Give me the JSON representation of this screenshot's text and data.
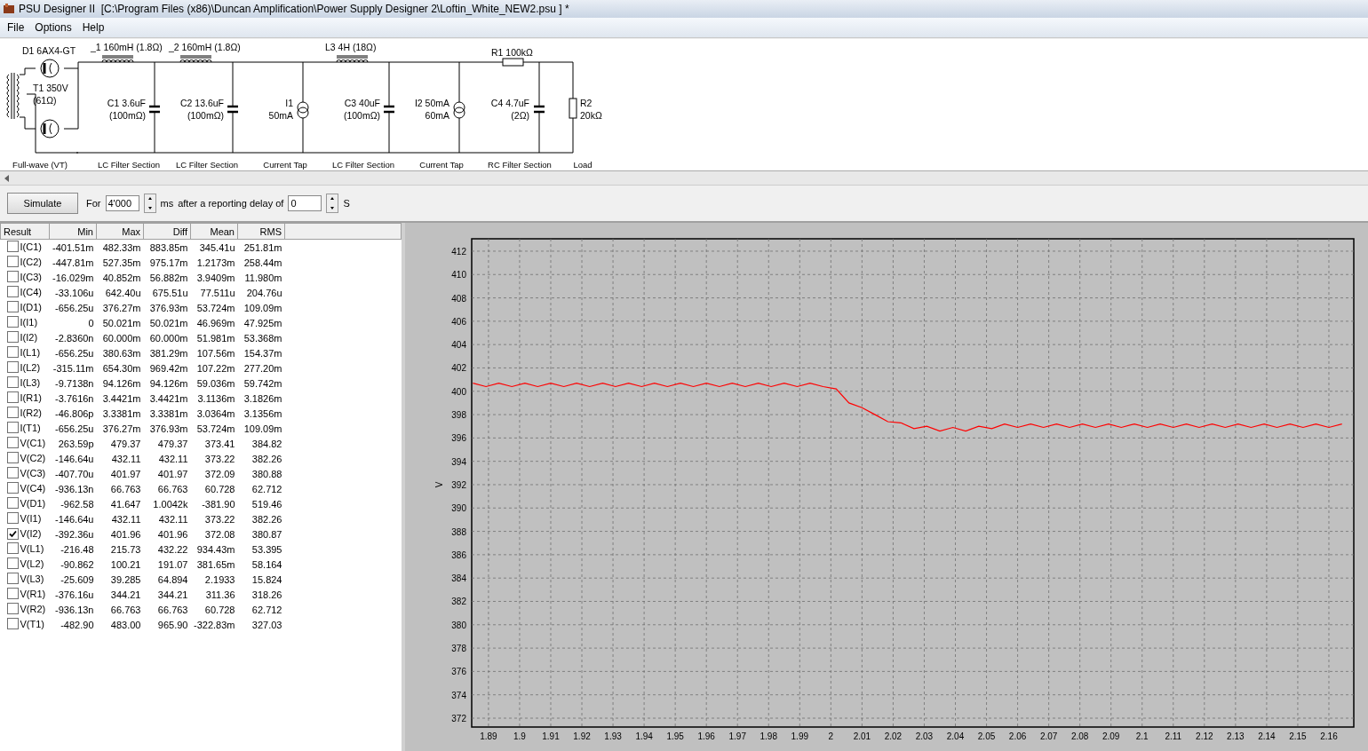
{
  "window": {
    "title": "PSU Designer II  [C:\\Program Files (x86)\\Duncan Amplification\\Power Supply Designer 2\\Loftin_White_NEW2.psu ] *"
  },
  "menu": [
    "File",
    "Options",
    "Help"
  ],
  "schematic": {
    "stages": [
      {
        "kind": "rectifier",
        "diode": "D1 6AX4-GT",
        "transformer": [
          "T1 350V",
          "(61Ω)"
        ],
        "section": "Full-wave (VT)"
      },
      {
        "kind": "lc",
        "inductor": "_1 160mH (1.8Ω)",
        "capacitor": [
          "C1 3.6uF",
          "(100mΩ)"
        ],
        "section": "LC Filter Section"
      },
      {
        "kind": "lc",
        "inductor": "_2 160mH (1.8Ω)",
        "capacitor": [
          "C2 13.6uF",
          "(100mΩ)"
        ],
        "section": "LC Filter Section"
      },
      {
        "kind": "tap",
        "source": [
          "I1",
          "50mA"
        ],
        "section": "Current Tap"
      },
      {
        "kind": "lc",
        "inductor": "L3 4H (18Ω)",
        "capacitor": [
          "C3 40uF",
          "(100mΩ)"
        ],
        "section": "LC Filter Section"
      },
      {
        "kind": "tap",
        "source": [
          "I2 50mA",
          "60mA"
        ],
        "section": "Current Tap"
      },
      {
        "kind": "rc",
        "resistor": "R1 100kΩ",
        "capacitor": [
          "C4 4.7uF",
          "(2Ω)"
        ],
        "section": "RC Filter Section"
      },
      {
        "kind": "load",
        "resistor": [
          "R2",
          "20kΩ"
        ],
        "section": "Load"
      }
    ]
  },
  "toolbar": {
    "simulate_button": "Simulate",
    "for_label": "For",
    "duration": "4'000",
    "duration_unit": "ms",
    "delay_label": "after a reporting delay of",
    "delay": "0",
    "delay_unit": "S"
  },
  "results": {
    "columns": [
      "Result",
      "Min",
      "Max",
      "Diff",
      "Mean",
      "RMS"
    ],
    "rows": [
      {
        "name": "I(C1)",
        "checked": false,
        "values": [
          "-401.51m",
          "482.33m",
          "883.85m",
          "345.41u",
          "251.81m"
        ]
      },
      {
        "name": "I(C2)",
        "checked": false,
        "values": [
          "-447.81m",
          "527.35m",
          "975.17m",
          "1.2173m",
          "258.44m"
        ]
      },
      {
        "name": "I(C3)",
        "checked": false,
        "values": [
          "-16.029m",
          "40.852m",
          "56.882m",
          "3.9409m",
          "11.980m"
        ]
      },
      {
        "name": "I(C4)",
        "checked": false,
        "values": [
          "-33.106u",
          "642.40u",
          "675.51u",
          "77.511u",
          "204.76u"
        ]
      },
      {
        "name": "I(D1)",
        "checked": false,
        "values": [
          "-656.25u",
          "376.27m",
          "376.93m",
          "53.724m",
          "109.09m"
        ]
      },
      {
        "name": "I(I1)",
        "checked": false,
        "values": [
          "0",
          "50.021m",
          "50.021m",
          "46.969m",
          "47.925m"
        ]
      },
      {
        "name": "I(I2)",
        "checked": false,
        "values": [
          "-2.8360n",
          "60.000m",
          "60.000m",
          "51.981m",
          "53.368m"
        ]
      },
      {
        "name": "I(L1)",
        "checked": false,
        "values": [
          "-656.25u",
          "380.63m",
          "381.29m",
          "107.56m",
          "154.37m"
        ]
      },
      {
        "name": "I(L2)",
        "checked": false,
        "values": [
          "-315.11m",
          "654.30m",
          "969.42m",
          "107.22m",
          "277.20m"
        ]
      },
      {
        "name": "I(L3)",
        "checked": false,
        "values": [
          "-9.7138n",
          "94.126m",
          "94.126m",
          "59.036m",
          "59.742m"
        ]
      },
      {
        "name": "I(R1)",
        "checked": false,
        "values": [
          "-3.7616n",
          "3.4421m",
          "3.4421m",
          "3.1136m",
          "3.1826m"
        ]
      },
      {
        "name": "I(R2)",
        "checked": false,
        "values": [
          "-46.806p",
          "3.3381m",
          "3.3381m",
          "3.0364m",
          "3.1356m"
        ]
      },
      {
        "name": "I(T1)",
        "checked": false,
        "values": [
          "-656.25u",
          "376.27m",
          "376.93m",
          "53.724m",
          "109.09m"
        ]
      },
      {
        "name": "V(C1)",
        "checked": false,
        "values": [
          "263.59p",
          "479.37",
          "479.37",
          "373.41",
          "384.82"
        ]
      },
      {
        "name": "V(C2)",
        "checked": false,
        "values": [
          "-146.64u",
          "432.11",
          "432.11",
          "373.22",
          "382.26"
        ]
      },
      {
        "name": "V(C3)",
        "checked": false,
        "values": [
          "-407.70u",
          "401.97",
          "401.97",
          "372.09",
          "380.88"
        ]
      },
      {
        "name": "V(C4)",
        "checked": false,
        "values": [
          "-936.13n",
          "66.763",
          "66.763",
          "60.728",
          "62.712"
        ]
      },
      {
        "name": "V(D1)",
        "checked": false,
        "values": [
          "-962.58",
          "41.647",
          "1.0042k",
          "-381.90",
          "519.46"
        ]
      },
      {
        "name": "V(I1)",
        "checked": false,
        "values": [
          "-146.64u",
          "432.11",
          "432.11",
          "373.22",
          "382.26"
        ]
      },
      {
        "name": "V(I2)",
        "checked": true,
        "values": [
          "-392.36u",
          "401.96",
          "401.96",
          "372.08",
          "380.87"
        ]
      },
      {
        "name": "V(L1)",
        "checked": false,
        "values": [
          "-216.48",
          "215.73",
          "432.22",
          "934.43m",
          "53.395"
        ]
      },
      {
        "name": "V(L2)",
        "checked": false,
        "values": [
          "-90.862",
          "100.21",
          "191.07",
          "381.65m",
          "58.164"
        ]
      },
      {
        "name": "V(L3)",
        "checked": false,
        "values": [
          "-25.609",
          "39.285",
          "64.894",
          "2.1933",
          "15.824"
        ]
      },
      {
        "name": "V(R1)",
        "checked": false,
        "values": [
          "-376.16u",
          "344.21",
          "344.21",
          "311.36",
          "318.26"
        ]
      },
      {
        "name": "V(R2)",
        "checked": false,
        "values": [
          "-936.13n",
          "66.763",
          "66.763",
          "60.728",
          "62.712"
        ]
      },
      {
        "name": "V(T1)",
        "checked": false,
        "values": [
          "-482.90",
          "483.00",
          "965.90",
          "-322.83m",
          "327.03"
        ]
      }
    ]
  },
  "chart": {
    "chart_data": {
      "type": "line",
      "ylabel": "V",
      "x": [
        1.885,
        1.8892,
        1.8933,
        1.8975,
        1.9017,
        1.9058,
        1.91,
        1.9142,
        1.9183,
        1.9225,
        1.9267,
        1.9308,
        1.935,
        1.9392,
        1.9433,
        1.9475,
        1.9517,
        1.9558,
        1.96,
        1.9642,
        1.9683,
        1.9725,
        1.9767,
        1.9808,
        1.985,
        1.9892,
        1.9933,
        1.9975,
        2.0017,
        2.0058,
        2.01,
        2.0142,
        2.0183,
        2.0225,
        2.0267,
        2.0308,
        2.035,
        2.0392,
        2.0433,
        2.0475,
        2.0517,
        2.0558,
        2.06,
        2.0642,
        2.0683,
        2.0725,
        2.0767,
        2.0808,
        2.085,
        2.0892,
        2.0933,
        2.0975,
        2.1017,
        2.1058,
        2.11,
        2.1142,
        2.1183,
        2.1225,
        2.1267,
        2.1308,
        2.135,
        2.1392,
        2.1433,
        2.1475,
        2.1517,
        2.1558,
        2.16,
        2.1642
      ],
      "grid": true,
      "series": [
        {
          "color": "#ff0000",
          "values": [
            400.7,
            400.4,
            400.7,
            400.4,
            400.7,
            400.4,
            400.7,
            400.4,
            400.7,
            400.4,
            400.7,
            400.4,
            400.7,
            400.4,
            400.7,
            400.4,
            400.7,
            400.4,
            400.7,
            400.4,
            400.7,
            400.4,
            400.7,
            400.4,
            400.7,
            400.4,
            400.7,
            400.4,
            400.2,
            399.0,
            398.6,
            398.0,
            397.4,
            397.3,
            396.8,
            397.0,
            396.6,
            396.9,
            396.6,
            397.0,
            396.8,
            397.2,
            396.9,
            397.2,
            396.9,
            397.2,
            396.9,
            397.2,
            396.9,
            397.2,
            396.9,
            397.2,
            396.9,
            397.2,
            396.9,
            397.2,
            396.9,
            397.2,
            396.9,
            397.2,
            396.9,
            397.2,
            396.9,
            397.2,
            396.9,
            397.2,
            396.9,
            397.2
          ]
        }
      ],
      "xlim": [
        1.8846,
        2.168
      ],
      "ylim": [
        371.24,
        413.06
      ],
      "xticks": [
        1.89,
        1.9,
        1.91,
        1.92,
        1.93,
        1.94,
        1.95,
        1.96,
        1.97,
        1.98,
        1.99,
        2,
        2.01,
        2.02,
        2.03,
        2.04,
        2.05,
        2.06,
        2.07,
        2.08,
        2.09,
        2.1,
        2.11,
        2.12,
        2.13,
        2.14,
        2.15,
        2.16
      ],
      "yticks": [
        372,
        374,
        376,
        378,
        380,
        382,
        384,
        386,
        388,
        390,
        392,
        394,
        396,
        398,
        400,
        402,
        404,
        406,
        408,
        410,
        412
      ]
    }
  }
}
